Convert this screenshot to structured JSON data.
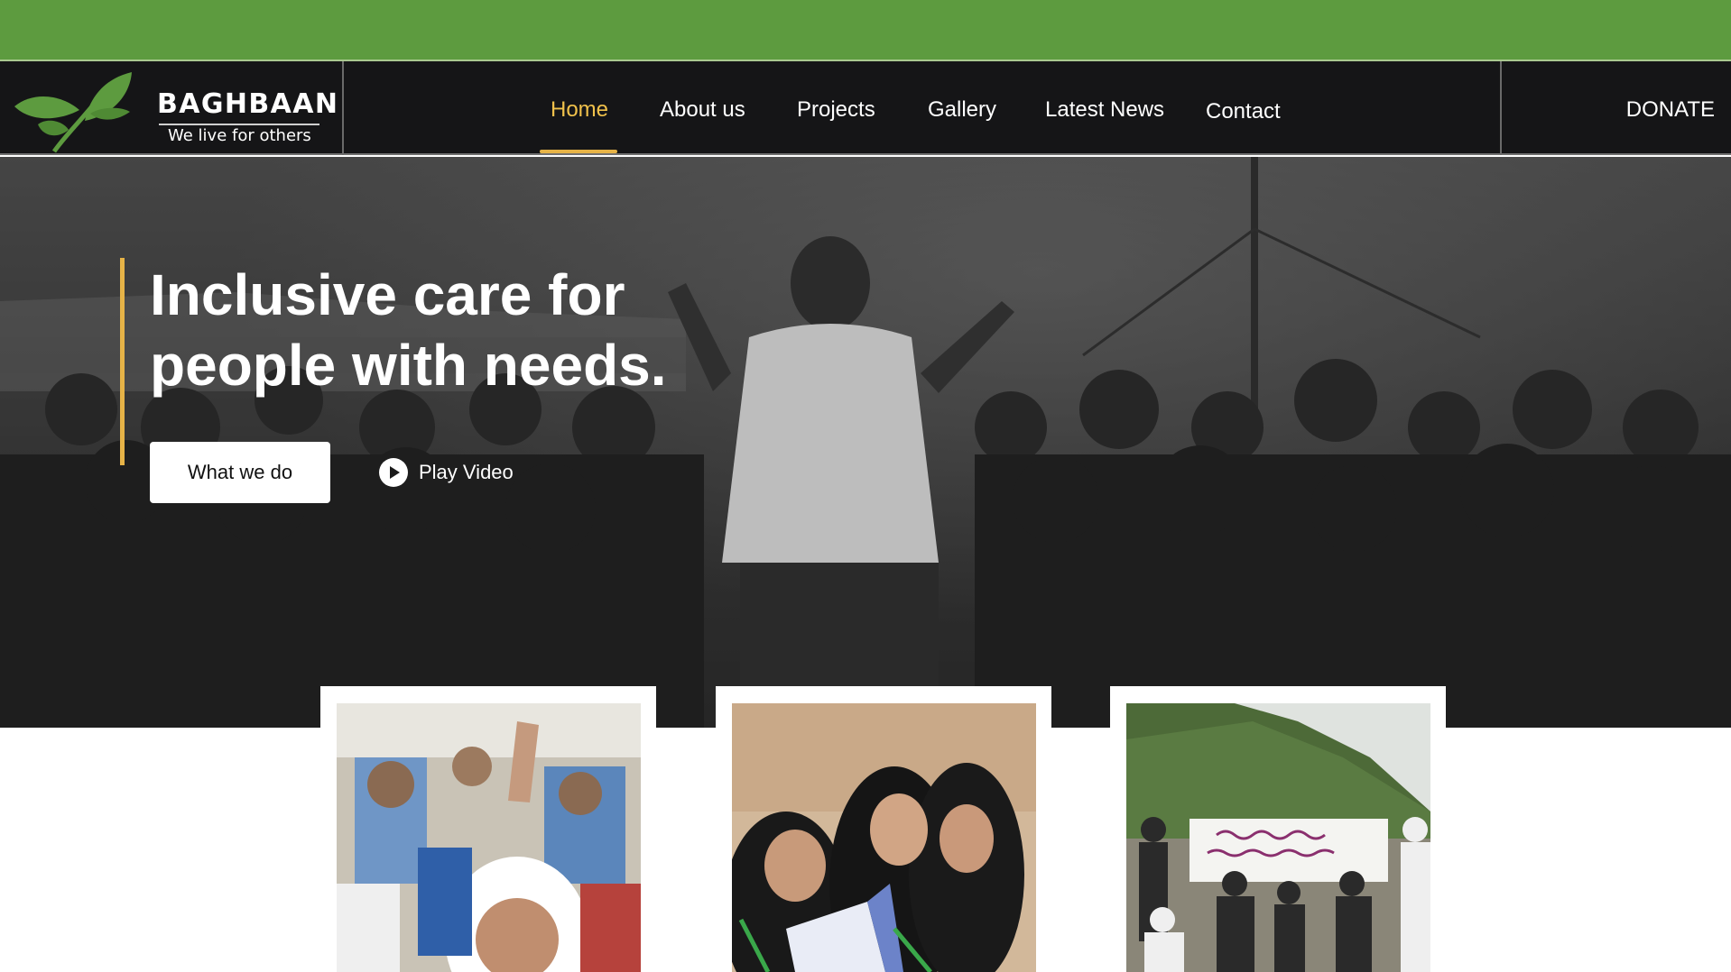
{
  "colors": {
    "topbar": "#5d9b3f",
    "header": "#151517",
    "accent": "#e6b347",
    "active_nav": "#f0c14b"
  },
  "brand": {
    "name": "BAGHBAAN",
    "tagline": "We live for others",
    "logo_icon": "leaf-icon"
  },
  "nav": {
    "items": [
      {
        "label": "Home",
        "active": true
      },
      {
        "label": "About us",
        "active": false
      },
      {
        "label": "Projects",
        "active": false
      },
      {
        "label": "Gallery",
        "active": false
      },
      {
        "label": "Latest News",
        "active": false
      },
      {
        "label": "Contact",
        "active": false
      }
    ],
    "donate_label": "DONATE"
  },
  "hero": {
    "title_line1": "Inclusive care for",
    "title_line2": "people with needs.",
    "primary_button": "What we do",
    "video_button": "Play Video",
    "video_icon": "play-circle-icon"
  },
  "cards": [
    {
      "image": "classroom-girls-raising-hands"
    },
    {
      "image": "girls-studying-with-notebooks"
    },
    {
      "image": "men-with-urdu-banner-in-mountains"
    }
  ]
}
